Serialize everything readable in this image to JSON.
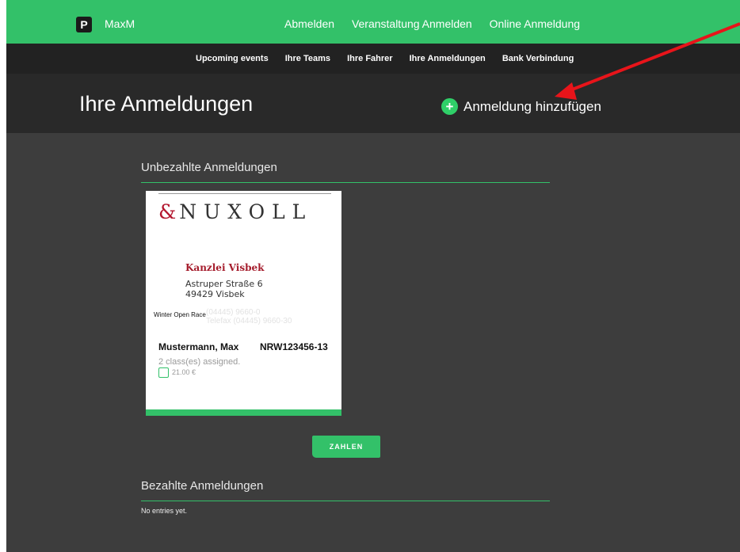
{
  "topbar": {
    "logo_glyph": "P",
    "brand": "MaxM",
    "nav": [
      "Abmelden",
      "Veranstaltung Anmelden",
      "Online Anmeldung"
    ]
  },
  "subnav": [
    "Upcoming events",
    "Ihre Teams",
    "Ihre Fahrer",
    "Ihre Anmeldungen",
    "Bank Verbindung"
  ],
  "header": {
    "title": "Ihre Anmeldungen",
    "add_icon": "+",
    "add_label": "Anmeldung hinzufügen"
  },
  "unpaid": {
    "title": "Unbezahlte Anmeldungen",
    "card": {
      "logo_amp": "&",
      "logo_name": "NUXOLL",
      "firm": "Kanzlei Visbek",
      "street": "Astruper Straße 6",
      "city": "49429 Visbek",
      "event": "Winter Open Race",
      "faded_phone": "(04445) 9660-0",
      "faded_fax": "Telefax (04445) 9660-30",
      "person": "Mustermann, Max",
      "plate": "NRW123456-13",
      "classes": "2 class(es) assigned.",
      "price": "21.00 €"
    }
  },
  "pay_button": "ZAHLEN",
  "paid": {
    "title": "Bezahlte Anmeldungen",
    "empty_text": "No entries yet."
  },
  "colors": {
    "accent": "#33c169",
    "background": "#3d3d3d",
    "arrow": "#e8141a"
  }
}
